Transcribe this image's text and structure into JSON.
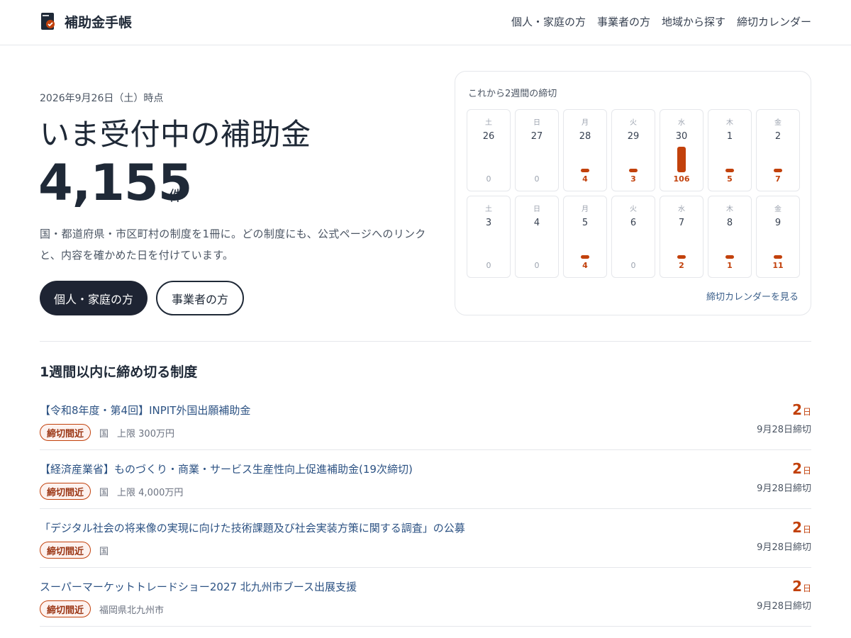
{
  "header": {
    "brand": "補助金手帳",
    "nav": [
      "個人・家庭の方",
      "事業者の方",
      "地域から探す",
      "締切カレンダー"
    ]
  },
  "hero": {
    "date": "2026年9月26日（土）時点",
    "title": "いま受付中の補助金",
    "count": "4,155",
    "unit": "件",
    "description": "国・都道府県・市区町村の制度を1冊に。どの制度にも、公式ページへのリンクと、内容を確かめた日を付けています。",
    "primary_button": "個人・家庭の方",
    "secondary_button": "事業者の方"
  },
  "calendar": {
    "title": "これから2週間の締切",
    "link": "締切カレンダーを見る",
    "accent_color": "#c2410c",
    "days": [
      {
        "weekday": "土",
        "date": "26",
        "count": 0
      },
      {
        "weekday": "日",
        "date": "27",
        "count": 0
      },
      {
        "weekday": "月",
        "date": "28",
        "count": 4
      },
      {
        "weekday": "火",
        "date": "29",
        "count": 3
      },
      {
        "weekday": "水",
        "date": "30",
        "count": 106
      },
      {
        "weekday": "木",
        "date": "1",
        "count": 5
      },
      {
        "weekday": "金",
        "date": "2",
        "count": 7
      },
      {
        "weekday": "土",
        "date": "3",
        "count": 0
      },
      {
        "weekday": "日",
        "date": "4",
        "count": 0
      },
      {
        "weekday": "月",
        "date": "5",
        "count": 4
      },
      {
        "weekday": "火",
        "date": "6",
        "count": 0
      },
      {
        "weekday": "水",
        "date": "7",
        "count": 2
      },
      {
        "weekday": "木",
        "date": "8",
        "count": 1
      },
      {
        "weekday": "金",
        "date": "9",
        "count": 11
      }
    ]
  },
  "deadline_section": {
    "title": "1週間以内に締め切る制度",
    "items": [
      {
        "title": "【令和8年度・第4回】INPIT外国出願補助金",
        "badge": "締切間近",
        "meta": [
          "国",
          "上限 300万円"
        ],
        "days": "2",
        "days_unit": "日",
        "deadline": "9月28日締切"
      },
      {
        "title": "【経済産業省】ものづくり・商業・サービス生産性向上促進補助金(19次締切)",
        "badge": "締切間近",
        "meta": [
          "国",
          "上限 4,000万円"
        ],
        "days": "2",
        "days_unit": "日",
        "deadline": "9月28日締切"
      },
      {
        "title": "「デジタル社会の将来像の実現に向けた技術課題及び社会実装方策に関する調査」の公募",
        "badge": "締切間近",
        "meta": [
          "国"
        ],
        "days": "2",
        "days_unit": "日",
        "deadline": "9月28日締切"
      },
      {
        "title": "スーパーマーケットトレードショー2027 北九州市ブース出展支援",
        "badge": "締切間近",
        "meta": [
          "福岡県北九州市"
        ],
        "days": "2",
        "days_unit": "日",
        "deadline": "9月28日締切"
      }
    ]
  }
}
